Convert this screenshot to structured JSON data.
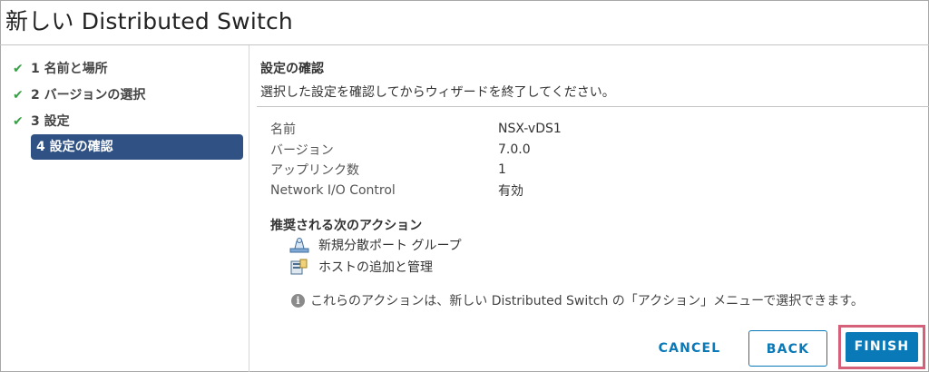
{
  "window": {
    "title": "新しい Distributed Switch"
  },
  "steps": [
    {
      "label": "1 名前と場所",
      "done": true
    },
    {
      "label": "2 バージョンの選択",
      "done": true
    },
    {
      "label": "3 設定",
      "done": true
    },
    {
      "label": "4 設定の確認",
      "done": false,
      "active": true
    }
  ],
  "main": {
    "section_title": "設定の確認",
    "section_desc": "選択した設定を確認してからウィザードを終了してください。",
    "summary": [
      {
        "key": "名前",
        "value": "NSX-vDS1"
      },
      {
        "key": "バージョン",
        "value": "7.0.0"
      },
      {
        "key": "アップリンク数",
        "value": "1"
      },
      {
        "key": "Network I/O Control",
        "value": "有効"
      }
    ],
    "actions_heading": "推奨される次のアクション",
    "actions": [
      {
        "label": "新規分散ポート グループ",
        "icon": "portgroup-icon"
      },
      {
        "label": "ホストの追加と管理",
        "icon": "host-icon"
      }
    ],
    "note": "これらのアクションは、新しい Distributed Switch の「アクション」メニューで選択できます。"
  },
  "footer": {
    "cancel": "CANCEL",
    "back": "BACK",
    "finish": "FINISH"
  },
  "colors": {
    "accent": "#0a79b8",
    "active_step": "#2f5183",
    "check": "#3aa047",
    "finish_highlight": "#d4607a"
  }
}
